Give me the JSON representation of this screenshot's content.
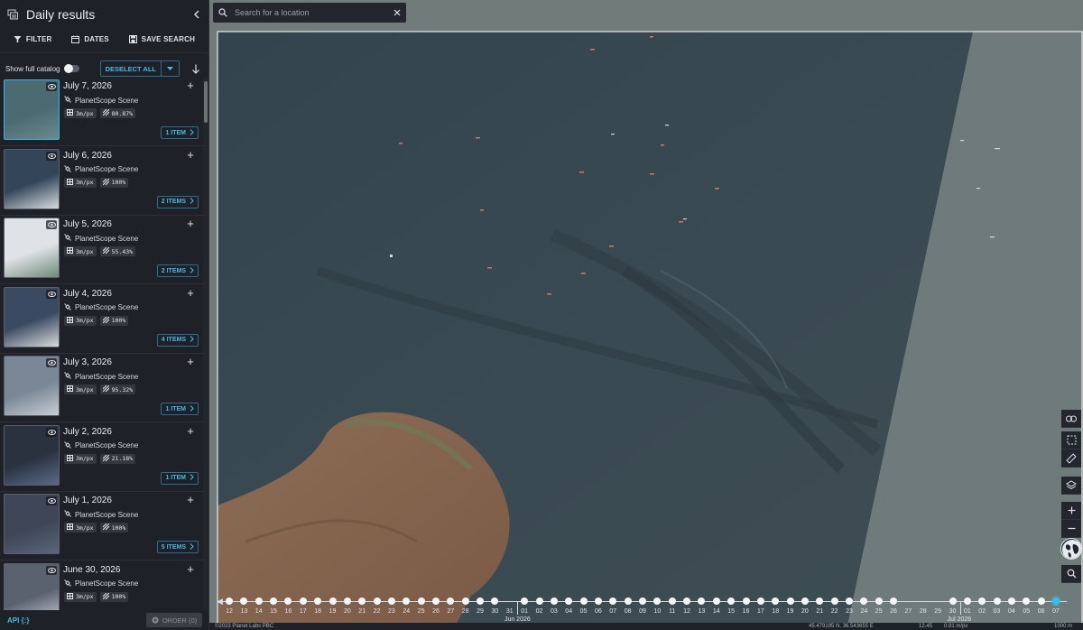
{
  "sidebar": {
    "title": "Daily results",
    "toolbar": {
      "filter": "FILTER",
      "dates": "DATES",
      "save_search": "SAVE SEARCH"
    },
    "show_full_catalog": "Show full catalog",
    "deselect_all": "DESELECT ALL",
    "results": [
      {
        "date": "July 7, 2026",
        "type": "PlanetScope Scene",
        "resolution": "3m/px",
        "coverage": "80.87%",
        "items": "1 ITEM",
        "selected": true
      },
      {
        "date": "July 6, 2026",
        "type": "PlanetScope Scene",
        "resolution": "3m/px",
        "coverage": "100%",
        "items": "2 ITEMS",
        "selected": false
      },
      {
        "date": "July 5, 2026",
        "type": "PlanetScope Scene",
        "resolution": "3m/px",
        "coverage": "55.43%",
        "items": "2 ITEMS",
        "selected": false
      },
      {
        "date": "July 4, 2026",
        "type": "PlanetScope Scene",
        "resolution": "3m/px",
        "coverage": "100%",
        "items": "4 ITEMS",
        "selected": false
      },
      {
        "date": "July 3, 2026",
        "type": "PlanetScope Scene",
        "resolution": "3m/px",
        "coverage": "95.32%",
        "items": "1 ITEM",
        "selected": false
      },
      {
        "date": "July 2, 2026",
        "type": "PlanetScope Scene",
        "resolution": "3m/px",
        "coverage": "21.18%",
        "items": "1 ITEM",
        "selected": false
      },
      {
        "date": "July 1, 2026",
        "type": "PlanetScope Scene",
        "resolution": "3m/px",
        "coverage": "100%",
        "items": "5 ITEMS",
        "selected": false
      },
      {
        "date": "June 30, 2026",
        "type": "PlanetScope Scene",
        "resolution": "3m/px",
        "coverage": "100%",
        "items": "",
        "selected": false
      }
    ],
    "footer": {
      "api": "API {:}",
      "order": "ORDER (0)"
    }
  },
  "map": {
    "search_placeholder": "Search for a location",
    "attribution": "©2023 Planet Labs PBC",
    "coordinates": "45.479195 N, 36.543655 E",
    "zoom": "12.45",
    "scale": "0.81 m/px",
    "scale_bar": "1000 m"
  },
  "timeline": {
    "ticks": [
      "12",
      "13",
      "14",
      "15",
      "16",
      "17",
      "18",
      "19",
      "20",
      "21",
      "22",
      "23",
      "24",
      "25",
      "26",
      "27",
      "28",
      "29",
      "30",
      "31",
      "01",
      "02",
      "03",
      "04",
      "05",
      "06",
      "07",
      "08",
      "09",
      "10",
      "11",
      "12",
      "13",
      "14",
      "15",
      "16",
      "17",
      "18",
      "19",
      "20",
      "21",
      "22",
      "23",
      "24",
      "25",
      "26",
      "27",
      "28",
      "29",
      "30",
      "01",
      "02",
      "03",
      "04",
      "05",
      "06",
      "07"
    ],
    "months": [
      "Jun 2026",
      "Jul 2026"
    ],
    "selected": "07"
  },
  "colors": {
    "accent": "#46b9e0",
    "selected_dot": "#35c0e8",
    "panel": "#1e2128"
  }
}
